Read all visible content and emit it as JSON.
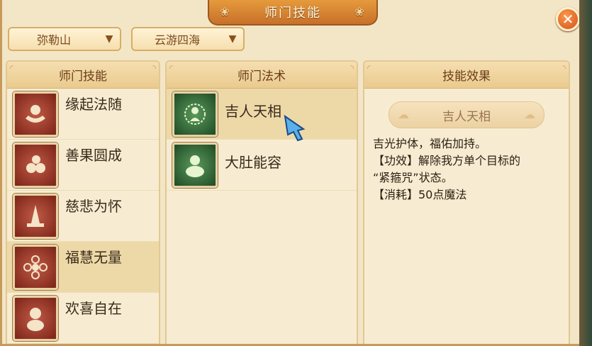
{
  "window": {
    "title": "师门技能",
    "close_label": "✕"
  },
  "filters": {
    "sect": "弥勒山",
    "mode": "云游四海"
  },
  "skills_panel": {
    "header": "师门技能",
    "items": [
      {
        "label": "缘起法随",
        "icon": "hand-offering-icon"
      },
      {
        "label": "善果圆成",
        "icon": "fruits-icon"
      },
      {
        "label": "慈悲为怀",
        "icon": "praying-hands-icon"
      },
      {
        "label": "福慧无量",
        "icon": "lotus-flower-icon",
        "selected": true
      },
      {
        "label": "欢喜自在",
        "icon": "laughing-buddha-icon"
      }
    ]
  },
  "spells_panel": {
    "header": "师门法术",
    "items": [
      {
        "label": "吉人天相",
        "icon": "glowing-figure-icon",
        "selected": true
      },
      {
        "label": "大肚能容",
        "icon": "buddha-figure-icon"
      }
    ]
  },
  "effect_panel": {
    "header": "技能效果",
    "skill_title": "吉人天相",
    "lines": [
      "吉光护体，福佑加持。",
      "【功效】解除我方单个目标的",
      "“紧箍咒”状态。",
      "【消耗】50点魔法"
    ]
  },
  "colors": {
    "accent": "#d0501a",
    "panel_bg": "#f7ecd2",
    "selected_row": "#edd9a8",
    "title_bar": "#e59a3c"
  }
}
